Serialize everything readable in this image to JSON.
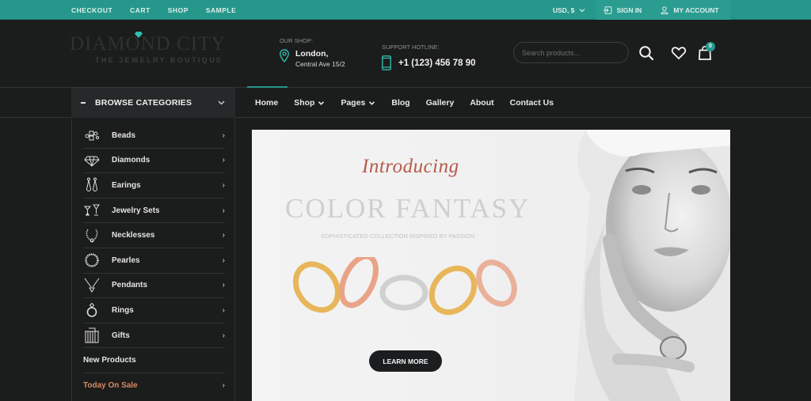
{
  "topbar": {
    "links": [
      "CHECKOUT",
      "CART",
      "SHOP",
      "SAMPLE"
    ],
    "currency": "USD, $",
    "sign_in": "SIGN IN",
    "my_account": "MY ACCOUNT"
  },
  "header": {
    "logo_name": "DIAMOND CITY",
    "logo_tagline": "THE JEWELRY BOUTIQUE",
    "shop_label": "OUR SHOP:",
    "shop_city": "London,",
    "shop_address": "Central Ave 15/2",
    "hotline_label": "SUPPORT HOTLINE:",
    "hotline_number": "+1 (123) 456 78 90",
    "search_placeholder": "Search products...",
    "cart_count": "0"
  },
  "nav": {
    "browse_label": "BROWSE CATEGORIES",
    "items": [
      {
        "label": "Home",
        "dropdown": false
      },
      {
        "label": "Shop",
        "dropdown": true
      },
      {
        "label": "Pages",
        "dropdown": true
      },
      {
        "label": "Blog",
        "dropdown": false
      },
      {
        "label": "Gallery",
        "dropdown": false
      },
      {
        "label": "About",
        "dropdown": false
      },
      {
        "label": "Contact Us",
        "dropdown": false
      }
    ]
  },
  "sidebar": {
    "categories": [
      {
        "label": "Beads",
        "icon": "beads-icon"
      },
      {
        "label": "Diamonds",
        "icon": "diamond-icon"
      },
      {
        "label": "Earings",
        "icon": "earrings-icon"
      },
      {
        "label": "Jewelry Sets",
        "icon": "jewelry-set-icon"
      },
      {
        "label": "Necklesses",
        "icon": "necklace-icon"
      },
      {
        "label": "Pearles",
        "icon": "pearls-icon"
      },
      {
        "label": "Pendants",
        "icon": "pendant-icon"
      },
      {
        "label": "Rings",
        "icon": "ring-icon"
      },
      {
        "label": "Gifts",
        "icon": "gift-icon"
      }
    ],
    "new_products": "New Products",
    "today_on_sale": "Today On Sale"
  },
  "banner": {
    "intro": "Introducing",
    "title": "COLOR FANTASY",
    "subtitle": "SOPHISTICATED COLLECTION INSPIRED BY PASSION",
    "button": "LEARN MORE"
  },
  "colors": {
    "accent": "#26978b",
    "background": "#1b1c1c",
    "sale": "#d88a63",
    "intro": "#b65b4a"
  }
}
